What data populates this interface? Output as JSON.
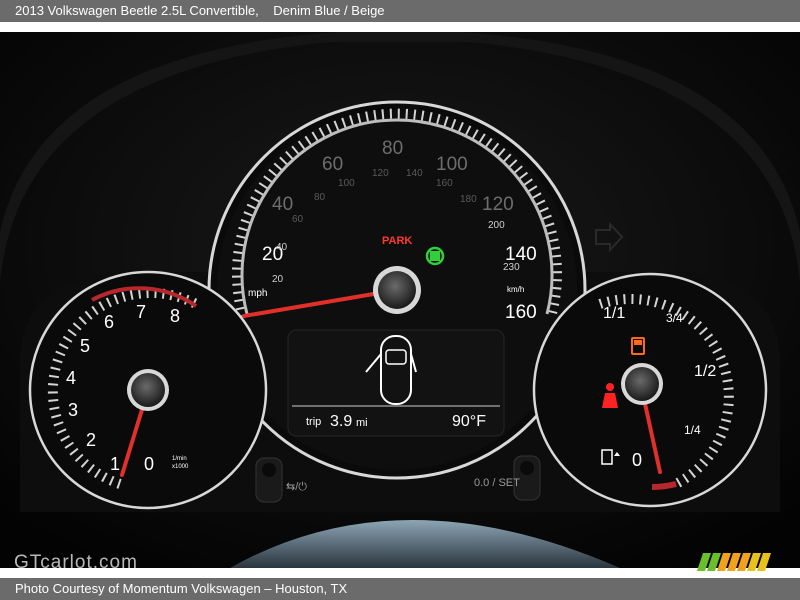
{
  "header": {
    "vehicle": "2013 Volkswagen Beetle 2.5L Convertible,",
    "colors": "Denim Blue / Beige"
  },
  "footer": {
    "credit": "Photo Courtesy of Momentum Volkswagen – Houston, TX",
    "watermark": "GTcarlot.com"
  },
  "speedometer": {
    "mph_labels": [
      "20",
      "40",
      "60",
      "80",
      "100",
      "120",
      "140",
      "160"
    ],
    "kmh_labels": [
      "20",
      "40",
      "60",
      "80",
      "100",
      "120",
      "140",
      "160",
      "180",
      "200",
      "230"
    ],
    "unit_mph": "mph",
    "unit_kmh": "km/h",
    "park_indicator": "PARK",
    "trip_label": "trip",
    "trip_value": "3.9",
    "trip_unit": "mi",
    "temperature": "90°F"
  },
  "tachometer": {
    "labels": [
      "0",
      "1",
      "2",
      "3",
      "4",
      "5",
      "6",
      "7",
      "8"
    ],
    "unit_line1": "1/min",
    "unit_line2": "x1000"
  },
  "fuel_gauge": {
    "labels": [
      "0",
      "1/4",
      "1/2",
      "3/4",
      "1/1"
    ]
  },
  "buttons": {
    "left_stalk_label": "⇆/⏻",
    "right_stalk_label": "0.0 / SET"
  },
  "colors": {
    "needle": "#e0302a",
    "park": "#ff3b2a",
    "indicator_green": "#2fd13b",
    "fuel_warning": "#ff6a1a",
    "seatbelt_warning": "#ff2222",
    "lcd_text": "#ffffff"
  },
  "icons": [
    "car-top-view-icon",
    "parking-brake-icon",
    "fuel-warning-icon",
    "seatbelt-warning-icon",
    "fuel-pump-icon",
    "arrow-right-icon"
  ]
}
